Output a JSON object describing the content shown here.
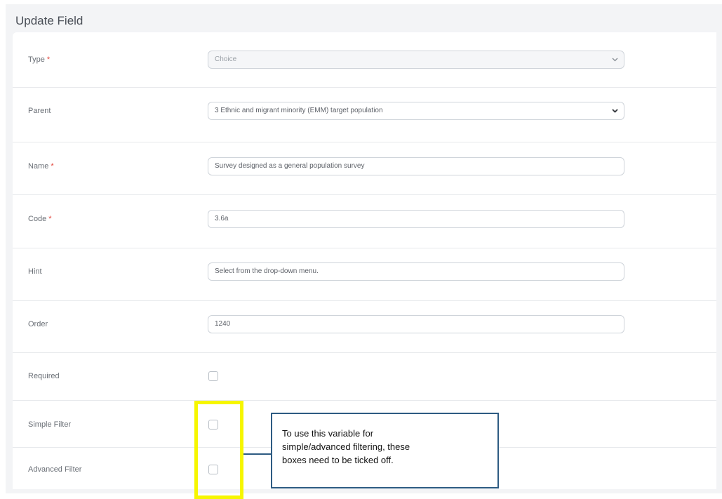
{
  "panel": {
    "title": "Update Field"
  },
  "required_marker": "*",
  "fields": {
    "type": {
      "label": "Type",
      "value": "Choice"
    },
    "parent": {
      "label": "Parent",
      "value": "3 Ethnic and migrant minority (EMM) target population"
    },
    "name": {
      "label": "Name",
      "value": "Survey designed as a general population survey"
    },
    "code": {
      "label": "Code",
      "value": "3.6a"
    },
    "hint": {
      "label": "Hint",
      "value": "Select from the drop-down menu."
    },
    "order": {
      "label": "Order",
      "value": "1240"
    },
    "required": {
      "label": "Required",
      "checked": false
    },
    "simple_filter": {
      "label": "Simple Filter",
      "checked": false
    },
    "advanced_filter": {
      "label": "Advanced Filter",
      "checked": false
    }
  },
  "annotation": {
    "lines": [
      "To use this variable for",
      "simple/advanced  filtering, these",
      "boxes  need to be ticked off."
    ],
    "highlight_color": "#f6f600",
    "border_color": "#2d5b82"
  },
  "icons": {
    "dropdown": "chevron-down-icon"
  }
}
